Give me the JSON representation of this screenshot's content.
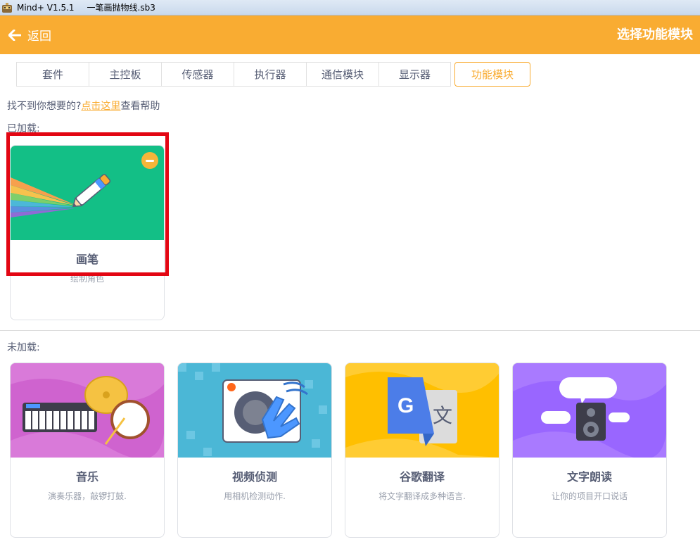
{
  "window": {
    "app_name": "Mind+ V1.5.1",
    "file_name": "一笔画抛物线.sb3"
  },
  "header": {
    "back_label": "返回",
    "title": "选择功能模块"
  },
  "tabs": [
    {
      "label": "套件"
    },
    {
      "label": "主控板"
    },
    {
      "label": "传感器"
    },
    {
      "label": "执行器"
    },
    {
      "label": "通信模块"
    },
    {
      "label": "显示器"
    },
    {
      "label": "功能模块",
      "active": true
    }
  ],
  "help": {
    "prefix": "找不到你想要的?",
    "link": "点击这里",
    "suffix": "查看帮助"
  },
  "loaded": {
    "label": "已加载:",
    "cards": [
      {
        "name": "画笔",
        "desc": "绘制角色"
      }
    ]
  },
  "not_loaded": {
    "label": "未加载:",
    "cards": [
      {
        "name": "音乐",
        "desc": "演奏乐器，敲锣打鼓."
      },
      {
        "name": "视频侦测",
        "desc": "用相机检测动作."
      },
      {
        "name": "谷歌翻译",
        "desc": "将文字翻译成多种语言."
      },
      {
        "name": "文字朗读",
        "desc": "让你的项目开口说话"
      }
    ]
  },
  "colors": {
    "accent": "#f9ac32",
    "pen_bg": "#13bf86",
    "music_bg": "#cf63cf",
    "video_bg": "#4bb7d6",
    "translate_bg": "#ffbf00",
    "tts_bg": "#9966ff",
    "highlight": "#e30613"
  }
}
